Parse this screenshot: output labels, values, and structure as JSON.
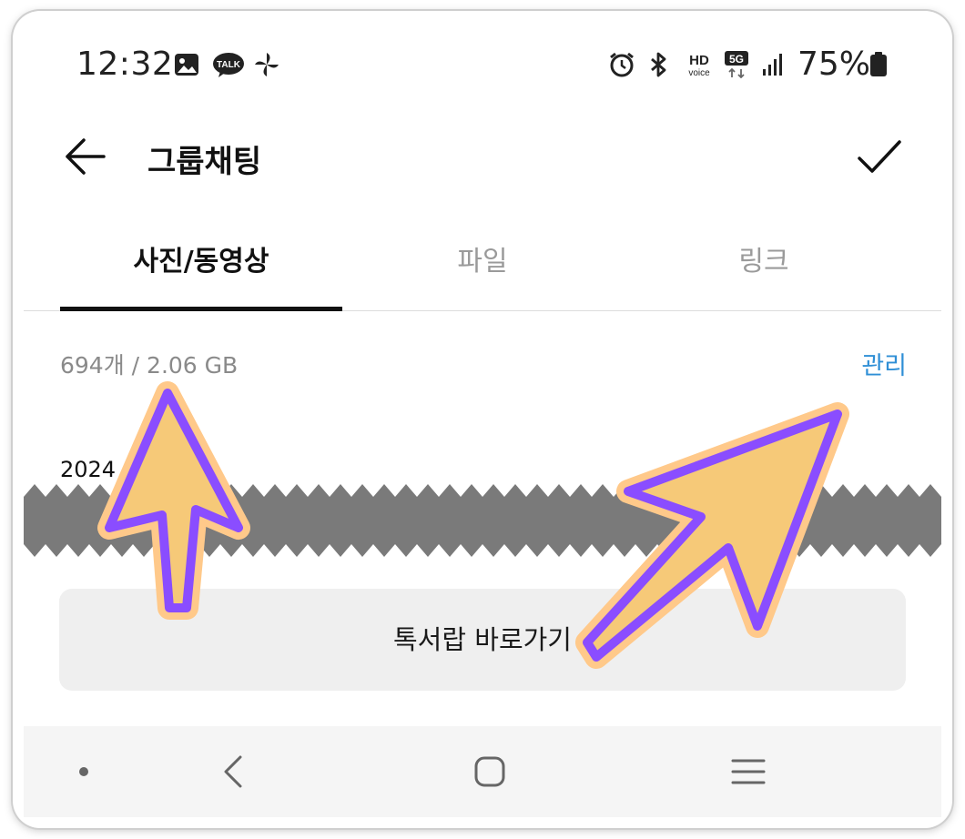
{
  "status_bar": {
    "time": "12:32",
    "battery_percent": "75%",
    "left_icons": [
      "gallery-icon",
      "kakaotalk-icon",
      "pinwheel-icon"
    ],
    "kakaotalk_label": "TALK",
    "hd_label": "HD",
    "voice_label": "voice",
    "network_label": "5G",
    "right_icons": [
      "alarm-icon",
      "bluetooth-icon",
      "hd-voice-icon",
      "5g-icon",
      "signal-icon",
      "battery-icon"
    ]
  },
  "header": {
    "title": "그룹채팅",
    "back_icon": "back-arrow-icon",
    "confirm_icon": "checkmark-icon"
  },
  "tabs": [
    {
      "label": "사진/동영상",
      "active": true
    },
    {
      "label": "파일",
      "active": false
    },
    {
      "label": "링크",
      "active": false
    }
  ],
  "summary": {
    "text": "694개 / 2.06 GB",
    "manage_label": "관리"
  },
  "section": {
    "year": "2024"
  },
  "shortcut_button": {
    "label": "톡서랍 바로가기"
  },
  "navbar": {
    "items": [
      "recent-dot-icon",
      "back-chevron-icon",
      "home-icon",
      "recents-menu-icon"
    ]
  },
  "colors": {
    "accent": "#2f8fd6",
    "arrow_fill": "#f6c978",
    "arrow_stroke": "#8a4dff",
    "arrow_halo": "#ffc98a",
    "tear_band": "#7a7a7a"
  }
}
